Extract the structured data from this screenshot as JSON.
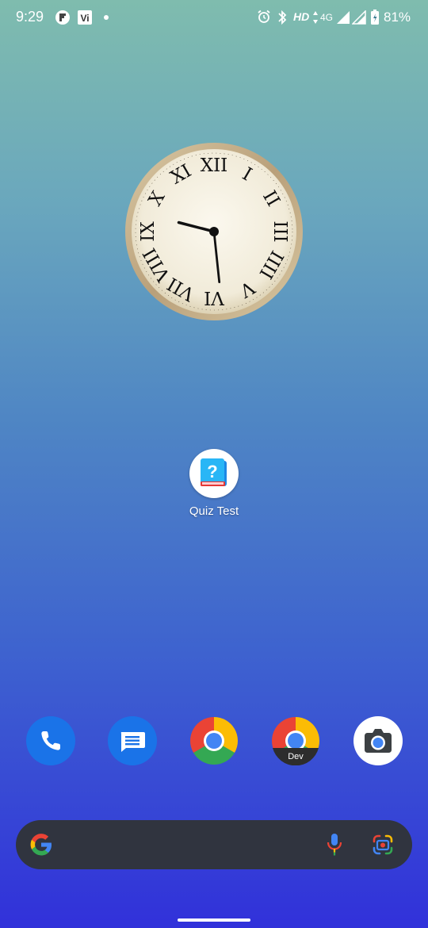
{
  "status_bar": {
    "time": "9:29",
    "notification_icons": [
      "flipboard-icon",
      "vi-icon"
    ],
    "vi_text": "Vi",
    "hd": "HD",
    "network": "4G",
    "battery": "81%"
  },
  "clock": {
    "type": "analog-roman",
    "numerals": [
      "XII",
      "I",
      "II",
      "III",
      "IIII",
      "V",
      "VI",
      "VII",
      "VIII",
      "IX",
      "X",
      "XI"
    ],
    "hour": 9,
    "minute": 29
  },
  "home": {
    "apps": [
      {
        "label": "Quiz Test",
        "icon": "quiz-book-icon",
        "glyph": "?"
      }
    ]
  },
  "dock": {
    "apps": [
      {
        "icon": "phone-icon"
      },
      {
        "icon": "messages-icon"
      },
      {
        "icon": "chrome-icon"
      },
      {
        "icon": "chrome-dev-icon",
        "badge": "Dev"
      },
      {
        "icon": "camera-icon"
      }
    ]
  },
  "search_bar": {
    "google_letter": "G",
    "icons": [
      "google-g-icon",
      "microphone-icon",
      "lens-icon"
    ]
  },
  "colors": {
    "google_blue": "#4285F4",
    "google_red": "#EA4335",
    "google_yellow": "#FBBC05",
    "google_green": "#34A853",
    "phone_blue": "#1a73e8",
    "search_bar_bg": "#30343f"
  }
}
